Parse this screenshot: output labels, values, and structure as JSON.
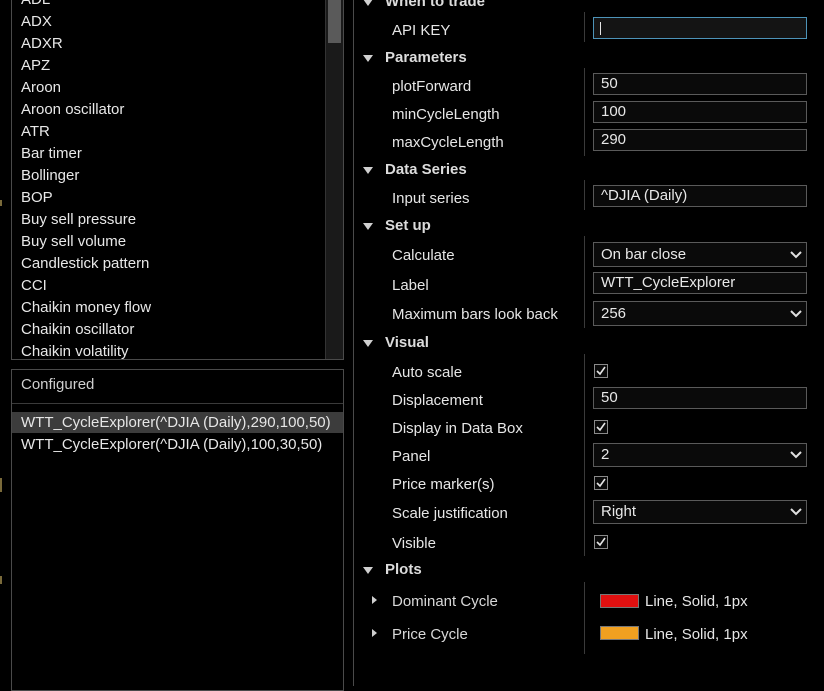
{
  "indicators": {
    "items": [
      "ADL",
      "ADX",
      "ADXR",
      "APZ",
      "Aroon",
      "Aroon oscillator",
      "ATR",
      "Bar timer",
      "Bollinger",
      "BOP",
      "Buy sell pressure",
      "Buy sell volume",
      "Candlestick pattern",
      "CCI",
      "Chaikin money flow",
      "Chaikin oscillator",
      "Chaikin volatility"
    ]
  },
  "configured": {
    "title": "Configured",
    "items": [
      "WTT_CycleExplorer(^DJIA (Daily),290,100,50)",
      "WTT_CycleExplorer(^DJIA (Daily),100,30,50)"
    ]
  },
  "props": {
    "when_to_trade": {
      "title": "When to trade",
      "api_key_label": "API KEY",
      "api_key_value": ""
    },
    "parameters": {
      "title": "Parameters",
      "plotForward_label": "plotForward",
      "plotForward_value": "50",
      "minCycleLength_label": "minCycleLength",
      "minCycleLength_value": "100",
      "maxCycleLength_label": "maxCycleLength",
      "maxCycleLength_value": "290"
    },
    "data_series": {
      "title": "Data Series",
      "input_label": "Input series",
      "input_value": "^DJIA (Daily)"
    },
    "setup": {
      "title": "Set up",
      "calculate_label": "Calculate",
      "calculate_value": "On bar close",
      "label_label": "Label",
      "label_value": "WTT_CycleExplorer",
      "maxbars_label": "Maximum bars look back",
      "maxbars_value": "256"
    },
    "visual": {
      "title": "Visual",
      "autoscale_label": "Auto scale",
      "autoscale_checked": true,
      "displacement_label": "Displacement",
      "displacement_value": "50",
      "databox_label": "Display in Data Box",
      "databox_checked": true,
      "panel_label": "Panel",
      "panel_value": "2",
      "pricemarker_label": "Price marker(s)",
      "pricemarker_checked": true,
      "scalejust_label": "Scale justification",
      "scalejust_value": "Right",
      "visible_label": "Visible",
      "visible_checked": true
    },
    "plots": {
      "title": "Plots",
      "items": [
        {
          "name": "Dominant Cycle",
          "color": "#e01010",
          "desc": "Line, Solid, 1px"
        },
        {
          "name": "Price Cycle",
          "color": "#f0a020",
          "desc": "Line, Solid, 1px"
        }
      ]
    }
  },
  "icons": {
    "dropdown": "chevron-down-icon",
    "expand": "triangle-down-icon",
    "collapse": "triangle-right-icon",
    "check": "checkmark-icon"
  }
}
